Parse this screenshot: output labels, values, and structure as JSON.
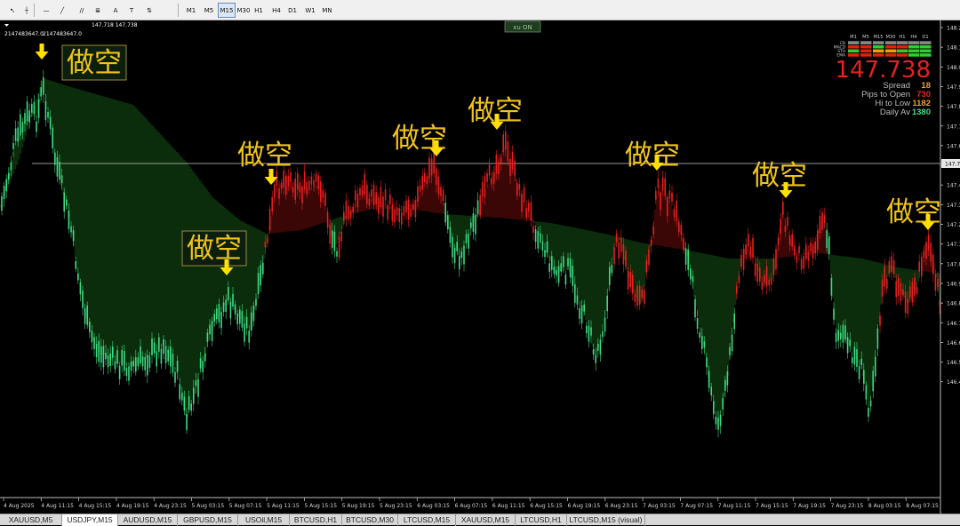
{
  "toolbar": {
    "tools": [
      {
        "name": "cursor-icon",
        "glyph": "↖"
      },
      {
        "name": "crosshair-icon",
        "glyph": "┼"
      },
      {
        "name": "horizontal-line-icon",
        "glyph": "—"
      },
      {
        "name": "trendline-icon",
        "glyph": "╱"
      },
      {
        "name": "channel-icon",
        "glyph": "//"
      },
      {
        "name": "fibonacci-icon",
        "glyph": "≣"
      },
      {
        "name": "text-icon",
        "glyph": "A"
      },
      {
        "name": "label-icon",
        "glyph": "T"
      },
      {
        "name": "arrows-icon",
        "glyph": "⇅"
      }
    ],
    "timeframes": [
      "M1",
      "M5",
      "M15",
      "M30",
      "H1",
      "H4",
      "D1",
      "W1",
      "MN"
    ]
  },
  "chart": {
    "top_left": [
      "2147483647.0",
      "2147483647.0"
    ],
    "bid_ask": "147.718 147.738",
    "xu_button": "xu ON",
    "price_levels": [
      "148.2",
      "148.1",
      "148.0",
      "147.9",
      "147.8",
      "147.7",
      "147.6",
      "147.5",
      "147.4",
      "147.3",
      "147.2",
      "147.1",
      "147.0",
      "146.9",
      "146.8",
      "146.7",
      "146.6",
      "146.5",
      "146.4"
    ],
    "current_price_tag": "147.7",
    "time_labels": [
      "4 Aug 2025",
      "4 Aug 11:15",
      "4 Aug 15:15",
      "4 Aug 19:15",
      "4 Aug 23:15",
      "5 Aug 03:15",
      "5 Aug 07:15",
      "5 Aug 11:15",
      "5 Aug 15:15",
      "5 Aug 19:15",
      "5 Aug 23:15",
      "6 Aug 03:15",
      "6 Aug 07:15",
      "6 Aug 11:15",
      "6 Aug 15:15",
      "6 Aug 19:15",
      "6 Aug 23:15",
      "7 Aug 03:15",
      "7 Aug 07:15",
      "7 Aug 11:15",
      "7 Aug 15:15",
      "7 Aug 19:15",
      "7 Aug 23:15",
      "8 Aug 03:15",
      "8 Aug 07:15"
    ],
    "annotations": [
      "做空",
      "做空",
      "做空",
      "做空",
      "做空",
      "做空",
      "做空",
      "做空"
    ],
    "colors": {
      "bull": "#3ddc84",
      "bear": "#e82020",
      "cloud": "#0b2d0b",
      "arrow": "#ffe000",
      "annot_text": "#f0c419"
    }
  },
  "panel": {
    "price": "147.738",
    "timeframes": [
      "M1",
      "M5",
      "M15",
      "M30",
      "H1",
      "H4",
      "D1"
    ],
    "row_labels": [
      "CB",
      "MACD",
      "STH",
      "EMA"
    ],
    "stats": [
      {
        "label": "Spread",
        "value": "18",
        "color": "#f0a020"
      },
      {
        "label": "Pips to Open",
        "value": "730",
        "color": "#e82020"
      },
      {
        "label": "Hi to Low",
        "value": "1182",
        "color": "#f0a020"
      },
      {
        "label": "Daily Av",
        "value": "1380",
        "color": "#3ddc84"
      }
    ]
  },
  "tabs": [
    {
      "label": "XAUUSD,M5",
      "active": false
    },
    {
      "label": "USDJPY,M15",
      "active": true
    },
    {
      "label": "AUDUSD,M15",
      "active": false
    },
    {
      "label": "GBPUSD,M15",
      "active": false
    },
    {
      "label": "USOil,M15",
      "active": false
    },
    {
      "label": "BTCUSD,H1",
      "active": false
    },
    {
      "label": "BTCUSD,M30",
      "active": false
    },
    {
      "label": "LTCUSD,M15",
      "active": false
    },
    {
      "label": "XAUUSD,M15",
      "active": false
    },
    {
      "label": "LTCUSD,H1",
      "active": false
    },
    {
      "label": "LTCUSD,M15 (visual)",
      "active": false
    }
  ]
}
